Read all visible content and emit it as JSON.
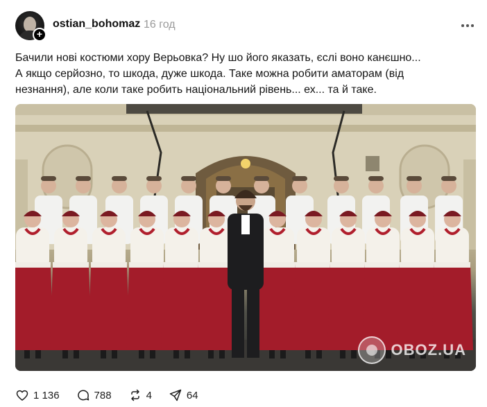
{
  "post": {
    "author": {
      "username": "ostian_bohomaz",
      "timestamp": "16 год"
    },
    "text": [
      "Бачили нові костюми хору Верьовка? Ну шо його яказать, єслі воно канєшно...",
      "А якщо серйозно, то шкода, дуже шкода. Таке можна робити аматорам (від",
      "незнання), але коли таке робить національний рівень... ех... та й таке."
    ],
    "media": {
      "watermark": "OBOZ.UA"
    },
    "actions": {
      "likes": "1 136",
      "replies": "788",
      "reposts": "4",
      "shares": "64"
    }
  },
  "icons": {
    "more": "more-horizontal-icon",
    "like": "heart-icon",
    "reply": "comment-icon",
    "repost": "repost-icon",
    "share": "send-icon",
    "follow": "plus-icon"
  },
  "colors": {
    "text": "#101010",
    "muted": "#999999",
    "skirt": "#a31c2a",
    "blouse": "#f4f1ea",
    "suit": "#1d1d1f"
  }
}
